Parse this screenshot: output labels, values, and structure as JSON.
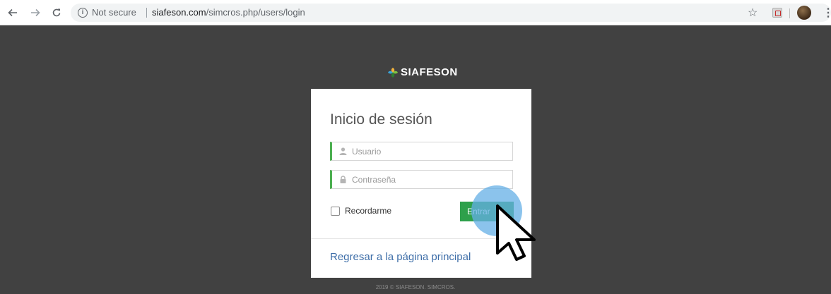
{
  "browser": {
    "security_label": "Not secure",
    "url_host": "siafeson.com",
    "url_path": "/simcros.php/users/login",
    "icons": {
      "back": "arrow-left-icon",
      "forward": "arrow-right-icon",
      "reload": "reload-icon",
      "info": "info-icon",
      "bookmark": "star-icon",
      "extension": "pdf-extension-icon",
      "profile": "profile-avatar",
      "menu": "kebab-menu-icon"
    }
  },
  "brand": {
    "name": "SIAFESON"
  },
  "login": {
    "title": "Inicio de sesión",
    "username_placeholder": "Usuario",
    "password_placeholder": "Contraseña",
    "remember_label": "Recordarme",
    "submit_label": "Entrar",
    "back_link": "Regresar a la página principal"
  },
  "footer": {
    "text": "2019 © SIAFESON. SIMCROS."
  },
  "colors": {
    "page_background": "#414141",
    "accent_green": "#2ea04b",
    "link_blue": "#3e6ea8",
    "click_highlight": "#64afe6"
  }
}
